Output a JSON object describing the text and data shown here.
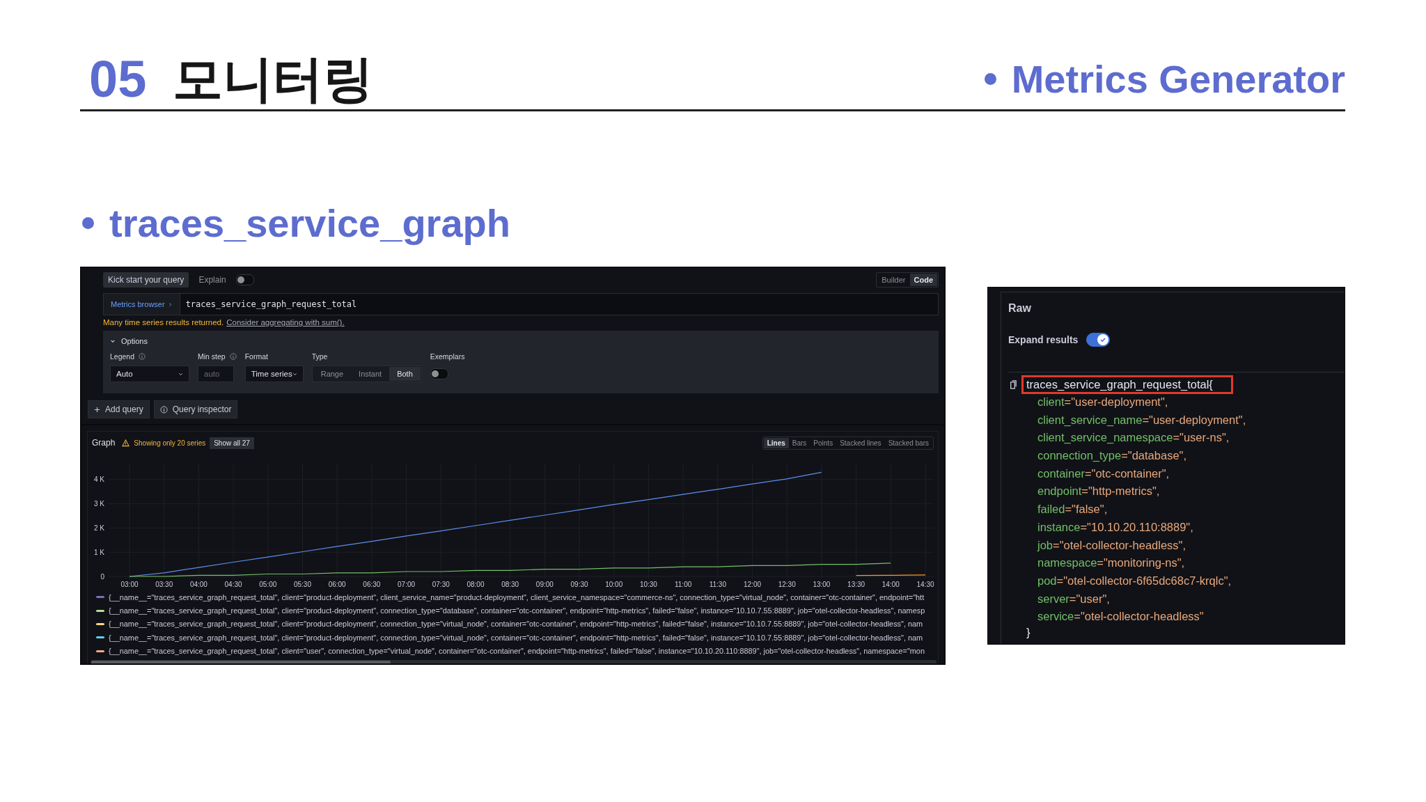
{
  "slide": {
    "section_number": "05",
    "section_title": "모니터링",
    "topic": "Metrics Generator",
    "subtitle": "traces_service_graph"
  },
  "query_editor": {
    "kick_start_button": "Kick start your query",
    "explain": {
      "label": "Explain",
      "on": false
    },
    "modes": [
      {
        "label": "Builder",
        "selected": false
      },
      {
        "label": "Code",
        "selected": true
      }
    ],
    "metrics_browser": "Metrics browser",
    "query": "traces_service_graph_request_total",
    "warning": "Many time series results returned.",
    "warning_link": "Consider aggregating with sum().",
    "options": {
      "toggle": "Options",
      "expanded": true,
      "legend": {
        "label": "Legend",
        "value": "Auto"
      },
      "min_step": {
        "label": "Min step",
        "placeholder": "auto"
      },
      "format": {
        "label": "Format",
        "value": "Time series"
      },
      "type": {
        "label": "Type",
        "options": [
          {
            "label": "Range",
            "selected": false
          },
          {
            "label": "Instant",
            "selected": false
          },
          {
            "label": "Both",
            "selected": true
          }
        ]
      },
      "exemplars": {
        "label": "Exemplars",
        "on": false
      }
    },
    "actions": [
      {
        "label": "Add query",
        "kind": "add"
      },
      {
        "label": "Query inspector",
        "kind": "inspect"
      }
    ]
  },
  "graph": {
    "title": "Graph",
    "notice": "Showing only 20 series",
    "show_all": "Show all 27",
    "styles": [
      {
        "label": "Lines",
        "selected": true
      },
      {
        "label": "Bars",
        "selected": false
      },
      {
        "label": "Points",
        "selected": false
      },
      {
        "label": "Stacked lines",
        "selected": false
      },
      {
        "label": "Stacked bars",
        "selected": false
      }
    ],
    "chart_data": {
      "type": "line",
      "categories": [
        "03:00",
        "03:30",
        "04:00",
        "04:30",
        "05:00",
        "05:30",
        "06:00",
        "06:30",
        "07:00",
        "07:30",
        "08:00",
        "08:30",
        "09:00",
        "09:30",
        "10:00",
        "10:30",
        "11:00",
        "11:30",
        "12:00",
        "12:30",
        "13:00",
        "13:30",
        "14:00",
        "14:30"
      ],
      "grid": true,
      "ylim": [
        0,
        4600
      ],
      "yticks": [
        {
          "value": 0,
          "label": "0"
        },
        {
          "value": 1000,
          "label": "1 K"
        },
        {
          "value": 2000,
          "label": "2 K"
        },
        {
          "value": 3000,
          "label": "3 K"
        },
        {
          "value": 4000,
          "label": "4 K"
        }
      ],
      "series": [
        {
          "color": "#5b8ff0",
          "values": [
            0,
            150,
            370,
            590,
            800,
            1020,
            1240,
            1450,
            1670,
            1880,
            2100,
            2320,
            2530,
            2750,
            2970,
            3170,
            3390,
            3600,
            3820,
            4030,
            4300,
            null,
            null,
            null
          ]
        },
        {
          "color": "#73bf69",
          "values": [
            0,
            0,
            50,
            50,
            100,
            100,
            150,
            150,
            200,
            200,
            250,
            250,
            300,
            300,
            350,
            350,
            400,
            400,
            450,
            450,
            500,
            500,
            550,
            null
          ]
        },
        {
          "color": "#ff9830",
          "values": [
            null,
            null,
            null,
            null,
            null,
            null,
            null,
            null,
            null,
            null,
            null,
            null,
            null,
            null,
            null,
            null,
            null,
            null,
            null,
            null,
            null,
            40,
            50,
            60
          ]
        }
      ]
    },
    "legend": [
      {
        "text": "{__name__=\"traces_service_graph_request_total\", client=\"product-deployment\", client_service_name=\"product-deployment\", client_service_namespace=\"commerce-ns\", connection_type=\"virtual_node\", container=\"otc-container\", endpoint=\"htt",
        "color": "#7a70b8"
      },
      {
        "text": "{__name__=\"traces_service_graph_request_total\", client=\"product-deployment\", connection_type=\"database\", container=\"otc-container\", endpoint=\"http-metrics\", failed=\"false\", instance=\"10.10.7.55:8889\", job=\"otel-collector-headless\", namesp",
        "color": "#b5e08f"
      },
      {
        "text": "{__name__=\"traces_service_graph_request_total\", client=\"product-deployment\", connection_type=\"virtual_node\", container=\"otc-container\", endpoint=\"http-metrics\", failed=\"false\", instance=\"10.10.7.55:8889\", job=\"otel-collector-headless\", nam",
        "color": "#f8d78a"
      },
      {
        "text": "{__name__=\"traces_service_graph_request_total\", client=\"product-deployment\", connection_type=\"virtual_node\", container=\"otc-container\", endpoint=\"http-metrics\", failed=\"false\", instance=\"10.10.7.55:8889\", job=\"otel-collector-headless\", nam",
        "color": "#5fd0ee"
      },
      {
        "text": "{__name__=\"traces_service_graph_request_total\", client=\"user\", connection_type=\"virtual_node\", container=\"otc-container\", endpoint=\"http-metrics\", failed=\"false\", instance=\"10.10.20.110:8889\", job=\"otel-collector-headless\", namespace=\"mon",
        "color": "#f7a98a"
      }
    ]
  },
  "raw": {
    "title": "Raw",
    "expand_results": {
      "label": "Expand results",
      "on": true
    },
    "metric": {
      "text": "traces_service_graph_request_total{",
      "highlighted": true
    },
    "labels": [
      "client=\"user-deployment\",",
      "client_service_name=\"user-deployment\",",
      "client_service_namespace=\"user-ns\",",
      "connection_type=\"database\",",
      "container=\"otc-container\",",
      "endpoint=\"http-metrics\",",
      "failed=\"false\",",
      "instance=\"10.10.20.110:8889\",",
      "job=\"otel-collector-headless\",",
      "namespace=\"monitoring-ns\",",
      "pod=\"otel-collector-6f65dc68c7-krqlc\",",
      "server=\"user\",",
      "service=\"otel-collector-headless\""
    ],
    "closing": "}"
  }
}
